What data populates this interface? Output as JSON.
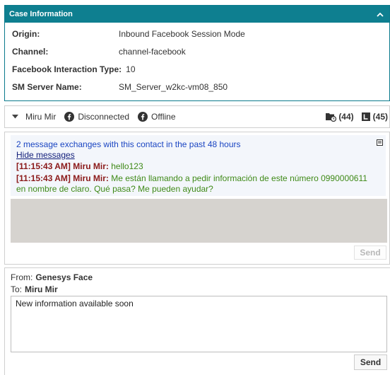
{
  "case_info": {
    "title": "Case Information",
    "rows": [
      {
        "label": "Origin:",
        "value": "Inbound Facebook Session Mode"
      },
      {
        "label": "Channel:",
        "value": "channel-facebook"
      },
      {
        "label": "Facebook Interaction Type:",
        "value": "10"
      },
      {
        "label": "SM Server Name:",
        "value": "SM_Server_w2kc-vm08_850"
      }
    ],
    "header_color": "#0e7f90"
  },
  "contact_bar": {
    "name": "Miru Mir",
    "status_connection": "Disconnected",
    "status_presence": "Offline",
    "count_cases": "(44)",
    "count_history": "(45)"
  },
  "transcript": {
    "history_text": "2 message exchanges with this contact in the past 48 hours",
    "hide_link": "Hide messages",
    "messages": [
      {
        "timestamp": "[11:15:43 AM] Miru Mir:",
        "text": " hello123"
      },
      {
        "timestamp": "[11:15:43 AM] Miru Mir:",
        "text": " Me están llamando a pedir información de este número 0990000611 en nombre de claro. Qué pasa? Me pueden ayudar?"
      }
    ],
    "send_label": "Send"
  },
  "email": {
    "from_label": "From:",
    "from_value": "Genesys Face",
    "to_label": "To:",
    "to_value": "Miru Mir",
    "body": "New information available soon",
    "send_label": "Send"
  }
}
